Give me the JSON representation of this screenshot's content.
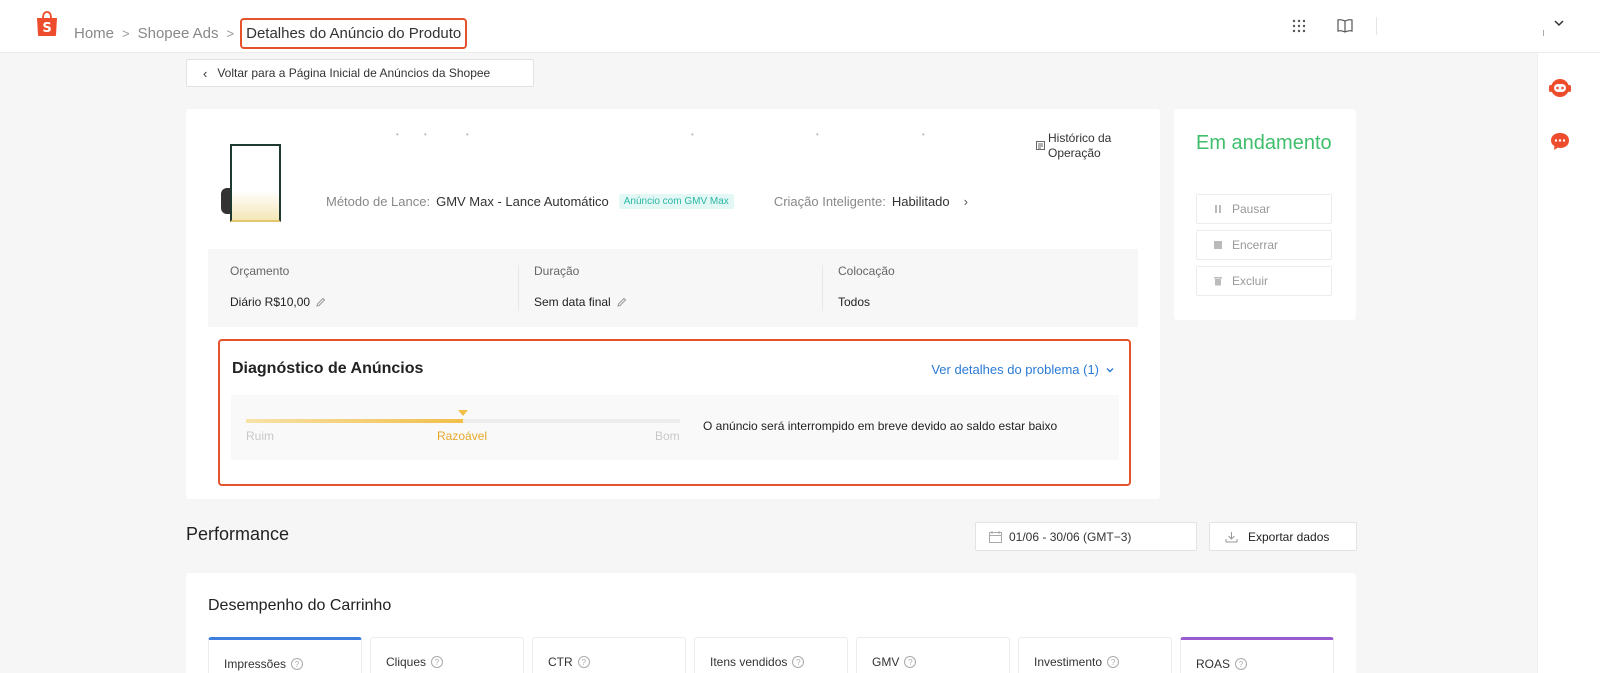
{
  "breadcrumb": {
    "home": "Home",
    "ads": "Shopee Ads",
    "current": "Detalhes do Anúncio do Produto"
  },
  "back_button": "Voltar para a Página Inicial de Anúncios da Shopee",
  "ad": {
    "history_label": "Histórico da Operação",
    "bid_method_label": "Método de Lance:",
    "bid_method_value": "GMV Max - Lance Automático",
    "gmv_tag": "Anúncio com GMV Max",
    "smart_creation_label": "Criação Inteligente:",
    "smart_creation_value": "Habilitado"
  },
  "info": {
    "budget_label": "Orçamento",
    "budget_value": "Diário R$10,00",
    "duration_label": "Duração",
    "duration_value": "Sem data final",
    "placement_label": "Colocação",
    "placement_value": "Todos"
  },
  "diagnostic": {
    "title": "Diagnóstico de Anúncios",
    "details_link": "Ver detalhes do problema (1)",
    "level_bad": "Ruim",
    "level_mid": "Razoável",
    "level_good": "Bom",
    "score_fraction": 0.5,
    "message": "O anúncio será interrompido em breve devido ao saldo estar baixo"
  },
  "status": {
    "title": "Em andamento",
    "pause": "Pausar",
    "end": "Encerrar",
    "delete": "Excluir",
    "color": "#3fbe6b"
  },
  "performance": {
    "title": "Performance",
    "date_range": "01/06 - 30/06 (GMT−3)",
    "export": "Exportar dados"
  },
  "cart": {
    "title": "Desempenho do Carrinho",
    "metrics": [
      "Impressões",
      "Cliques",
      "CTR",
      "Itens vendidos",
      "GMV",
      "Investimento",
      "ROAS"
    ]
  },
  "colors": {
    "accent_red": "#e5532d",
    "link_blue": "#2b7bd6",
    "bar_gold": "#f1bf4a",
    "shopee_orange": "#ee4d2d"
  }
}
